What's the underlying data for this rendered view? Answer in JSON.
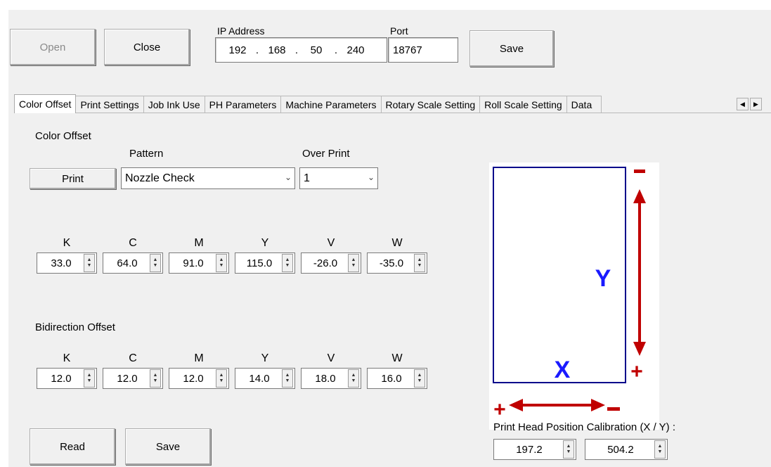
{
  "toolbar": {
    "open_label": "Open",
    "close_label": "Close",
    "ip_label": "IP Address",
    "ip": [
      "192",
      "168",
      "50",
      "240"
    ],
    "port_label": "Port",
    "port_value": "18767",
    "save_label": "Save"
  },
  "tabs": [
    "Color Offset",
    "Print Settings",
    "Job Ink Use",
    "PH Parameters",
    "Machine Parameters",
    "Rotary Scale Setting",
    "Roll Scale Setting",
    "Data"
  ],
  "color_offset": {
    "section_title": "Color Offset",
    "pattern_label": "Pattern",
    "overprint_label": "Over Print",
    "print_label": "Print",
    "pattern_value": "Nozzle Check",
    "overprint_value": "1",
    "channels": [
      "K",
      "C",
      "M",
      "Y",
      "V",
      "W"
    ],
    "values": [
      "33.0",
      "64.0",
      "91.0",
      "115.0",
      "-26.0",
      "-35.0"
    ]
  },
  "bidirection": {
    "section_title": "Bidirection Offset",
    "channels": [
      "K",
      "C",
      "M",
      "Y",
      "V",
      "W"
    ],
    "values": [
      "12.0",
      "12.0",
      "12.0",
      "14.0",
      "18.0",
      "16.0"
    ]
  },
  "buttons": {
    "read_label": "Read",
    "save_label": "Save"
  },
  "diagram": {
    "y_label": "Y",
    "x_label": "X",
    "plus": "+",
    "minus": "−",
    "box_color": "#00008b",
    "arrow_color": "#c00000",
    "letter_color": "#1a1aff"
  },
  "calibration": {
    "label": "Print Head Position Calibration (X / Y) :",
    "x_value": "197.2",
    "y_value": "504.2"
  }
}
